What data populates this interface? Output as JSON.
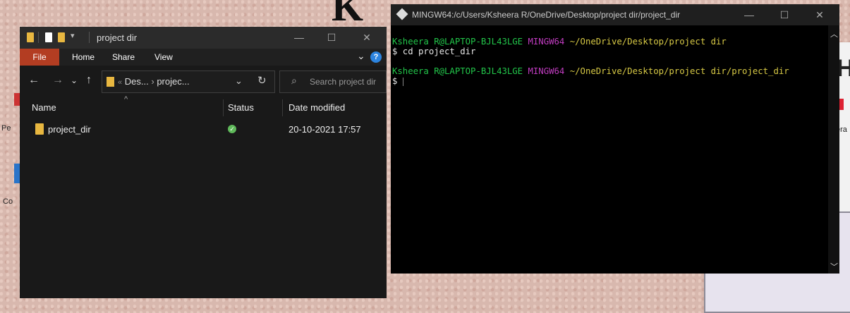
{
  "desktop": {
    "left_labels": [
      "Pe",
      "Co"
    ],
    "right_letter": "H",
    "right_label": "era"
  },
  "explorer": {
    "title": "project dir",
    "ribbon": {
      "file": "File",
      "home": "Home",
      "share": "Share",
      "view": "View",
      "help": "?"
    },
    "address": {
      "prefix": "«",
      "crumb1": "Des...",
      "sep": "›",
      "crumb2": "projec..."
    },
    "search_placeholder": "Search project dir",
    "columns": {
      "name": "Name",
      "status": "Status",
      "date": "Date modified"
    },
    "rows": [
      {
        "name": "project_dir",
        "date": "20-10-2021 17:57"
      }
    ]
  },
  "terminal": {
    "title": "MINGW64:/c/Users/Ksheera R/OneDrive/Desktop/project dir/project_dir",
    "lines": [
      {
        "user": "Ksheera R@LAPTOP-BJL43LGE",
        "shell": "MINGW64",
        "path": "~/OneDrive/Desktop/project dir"
      },
      {
        "cmd": "$ cd project_dir"
      },
      {
        "user": "Ksheera R@LAPTOP-BJL43LGE",
        "shell": "MINGW64",
        "path": "~/OneDrive/Desktop/project dir/project_dir"
      },
      {
        "cmd": "$ "
      }
    ]
  }
}
